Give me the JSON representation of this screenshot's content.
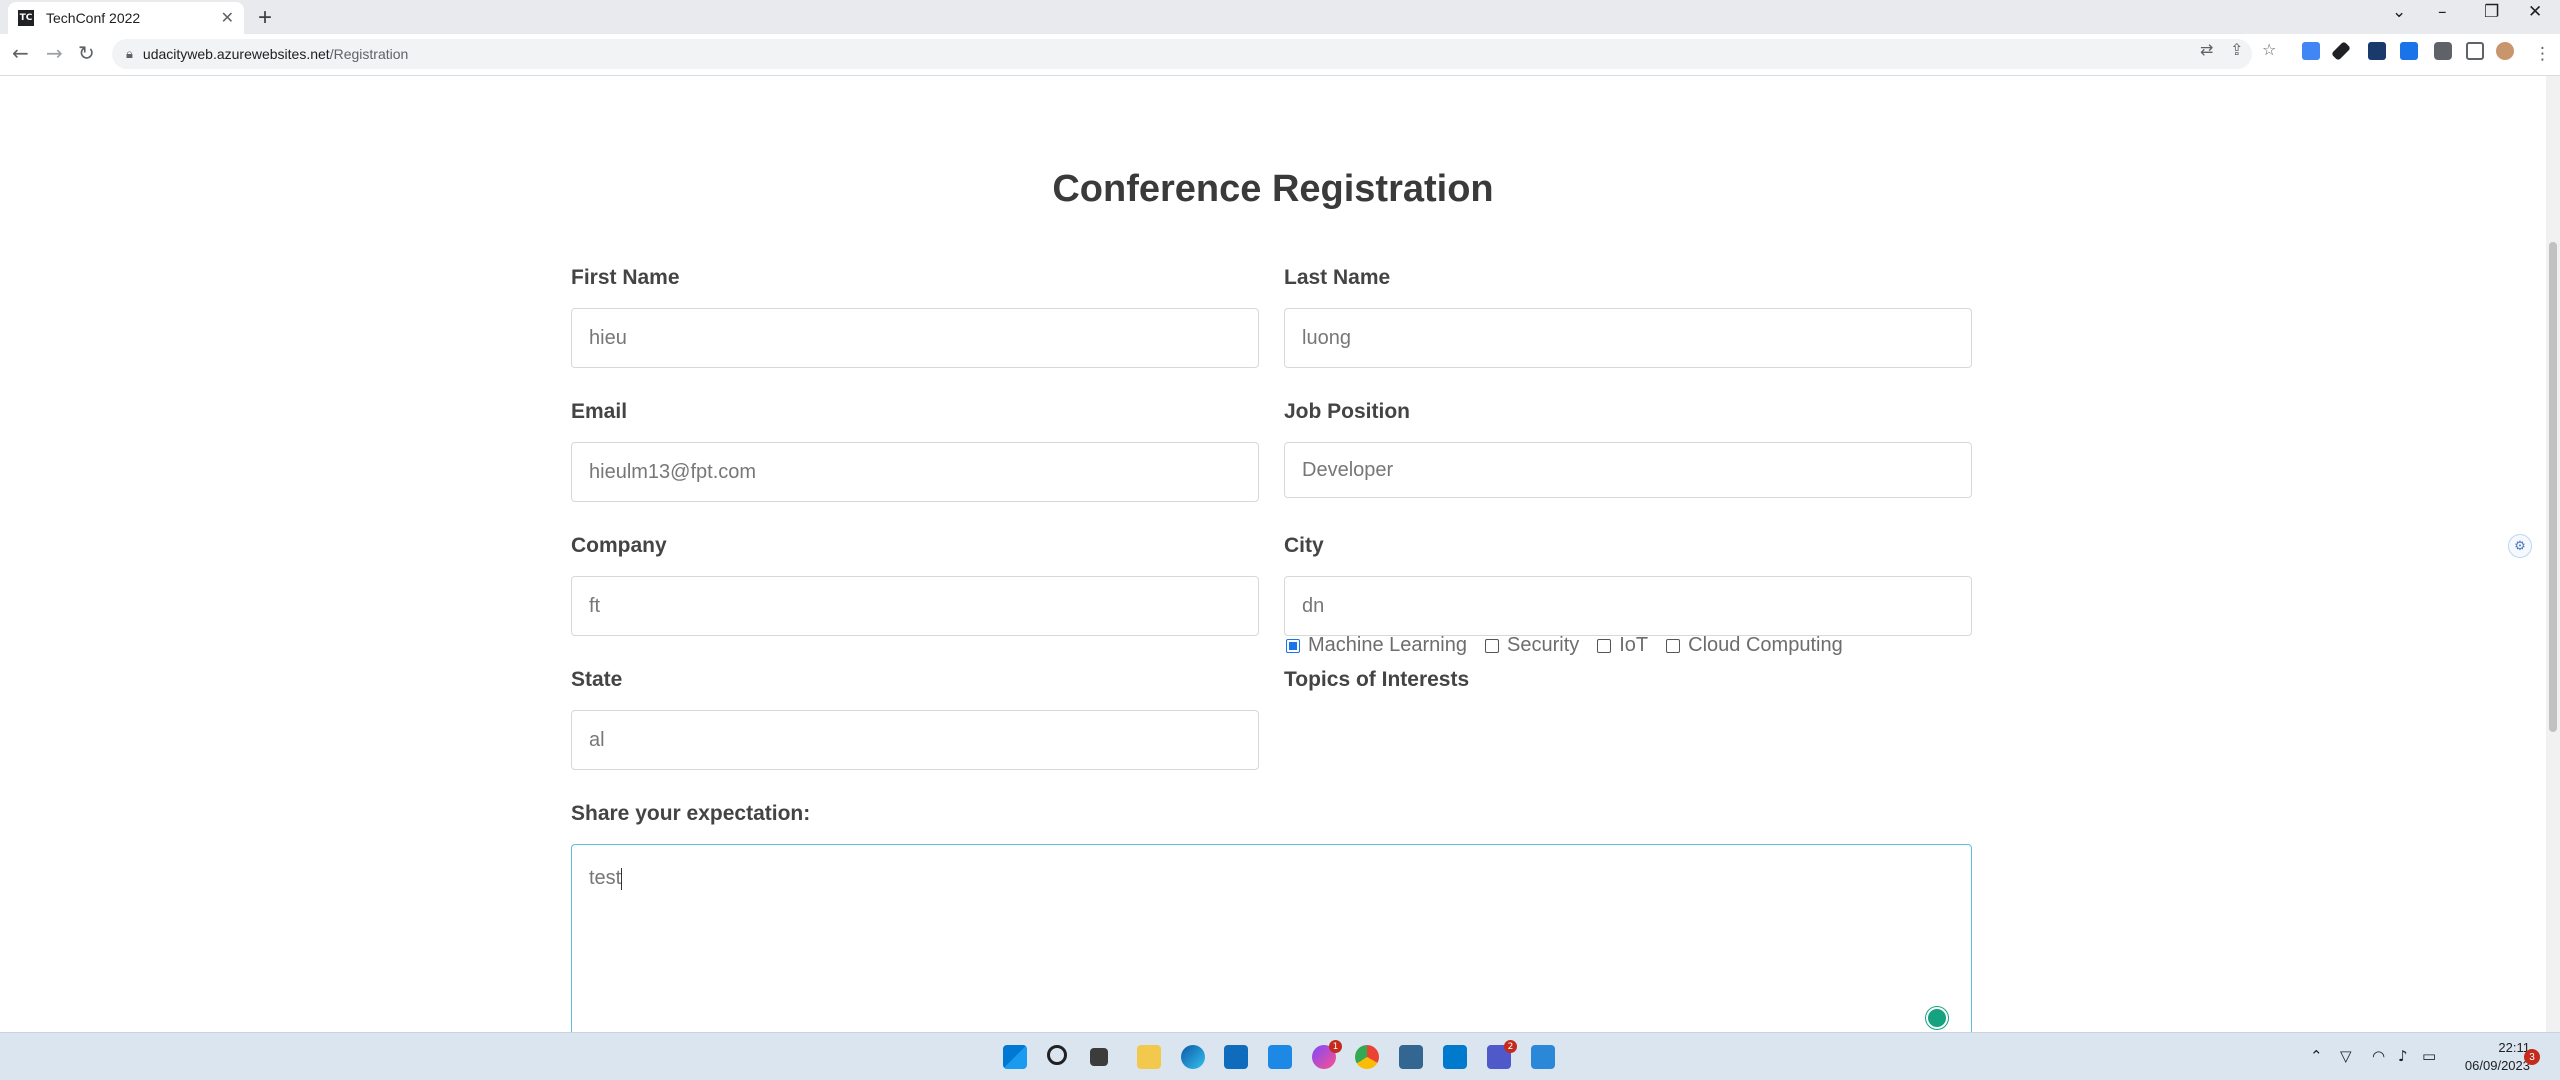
{
  "browser": {
    "tab_title": "TechConf 2022",
    "favicon_text": "TC",
    "url_host": "udacityweb.azurewebsites.net",
    "url_path": "/Registration"
  },
  "page": {
    "title": "Conference Registration",
    "first_name": {
      "label": "First Name",
      "value": "hieu"
    },
    "last_name": {
      "label": "Last Name",
      "value": "luong"
    },
    "email": {
      "label": "Email",
      "value": "hieulm13@fpt.com"
    },
    "job_position": {
      "label": "Job Position",
      "value": "Developer"
    },
    "company": {
      "label": "Company",
      "value": "ft"
    },
    "city": {
      "label": "City",
      "value": "dn"
    },
    "state": {
      "label": "State",
      "value": "al"
    },
    "topics": {
      "label": "Topics of Interests",
      "options": [
        {
          "label": "Machine Learning",
          "checked": true
        },
        {
          "label": "Security",
          "checked": false
        },
        {
          "label": "IoT",
          "checked": false
        },
        {
          "label": "Cloud Computing",
          "checked": false
        }
      ]
    },
    "expectation": {
      "label": "Share your expectation:",
      "value": "test"
    }
  },
  "taskbar": {
    "messenger_badge": "1",
    "teams_badge": "2",
    "time": "22:11",
    "date": "06/09/2023",
    "notification_count": "3"
  },
  "icons": {
    "back": "arrow-left-icon",
    "forward": "arrow-right-icon",
    "reload": "reload-icon",
    "lock": "lock-icon",
    "bookmark": "star-icon",
    "share": "share-icon",
    "translate": "translate-icon",
    "extensions": "puzzle-icon"
  }
}
